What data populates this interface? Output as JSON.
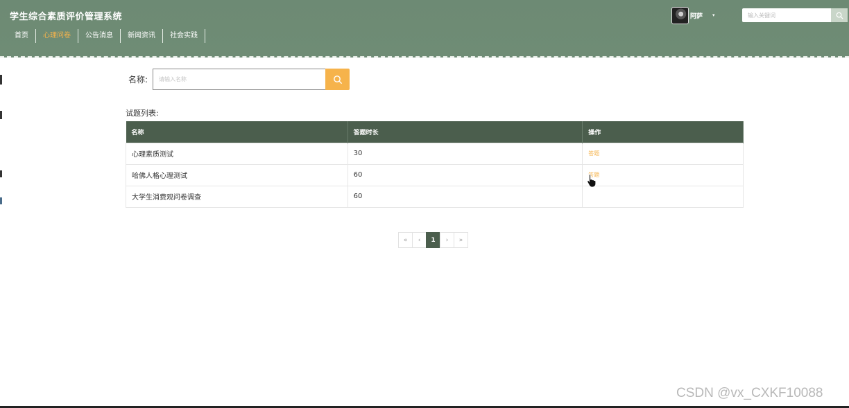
{
  "header": {
    "title": "学生综合素质评价管理系统",
    "nav": [
      {
        "label": "首页",
        "active": false
      },
      {
        "label": "心理问卷",
        "active": true
      },
      {
        "label": "公告消息",
        "active": false
      },
      {
        "label": "新闻资讯",
        "active": false
      },
      {
        "label": "社会实践",
        "active": false
      }
    ],
    "user": {
      "name": "阿萨",
      "caret": "▾"
    },
    "search": {
      "placeholder": "输入关键词"
    }
  },
  "filter": {
    "label": "名称:",
    "placeholder": "请输入名称"
  },
  "list": {
    "title": "试题列表:",
    "columns": [
      "名称",
      "答题时长",
      "操作"
    ],
    "rows": [
      {
        "name": "心理素质测试",
        "duration": "30",
        "action": "答题"
      },
      {
        "name": "哈佛人格心理测试",
        "duration": "60",
        "action": "答题"
      },
      {
        "name": "大学生消费观问卷调查",
        "duration": "60",
        "action": ""
      }
    ]
  },
  "pagination": {
    "first": "«",
    "prev": "‹",
    "current": "1",
    "next": "›",
    "last": "»"
  },
  "watermark": "CSDN @vx_CXKF10088",
  "colors": {
    "header_bg": "#6f8c75",
    "table_header": "#4b5e4d",
    "accent": "#f6b34b"
  }
}
